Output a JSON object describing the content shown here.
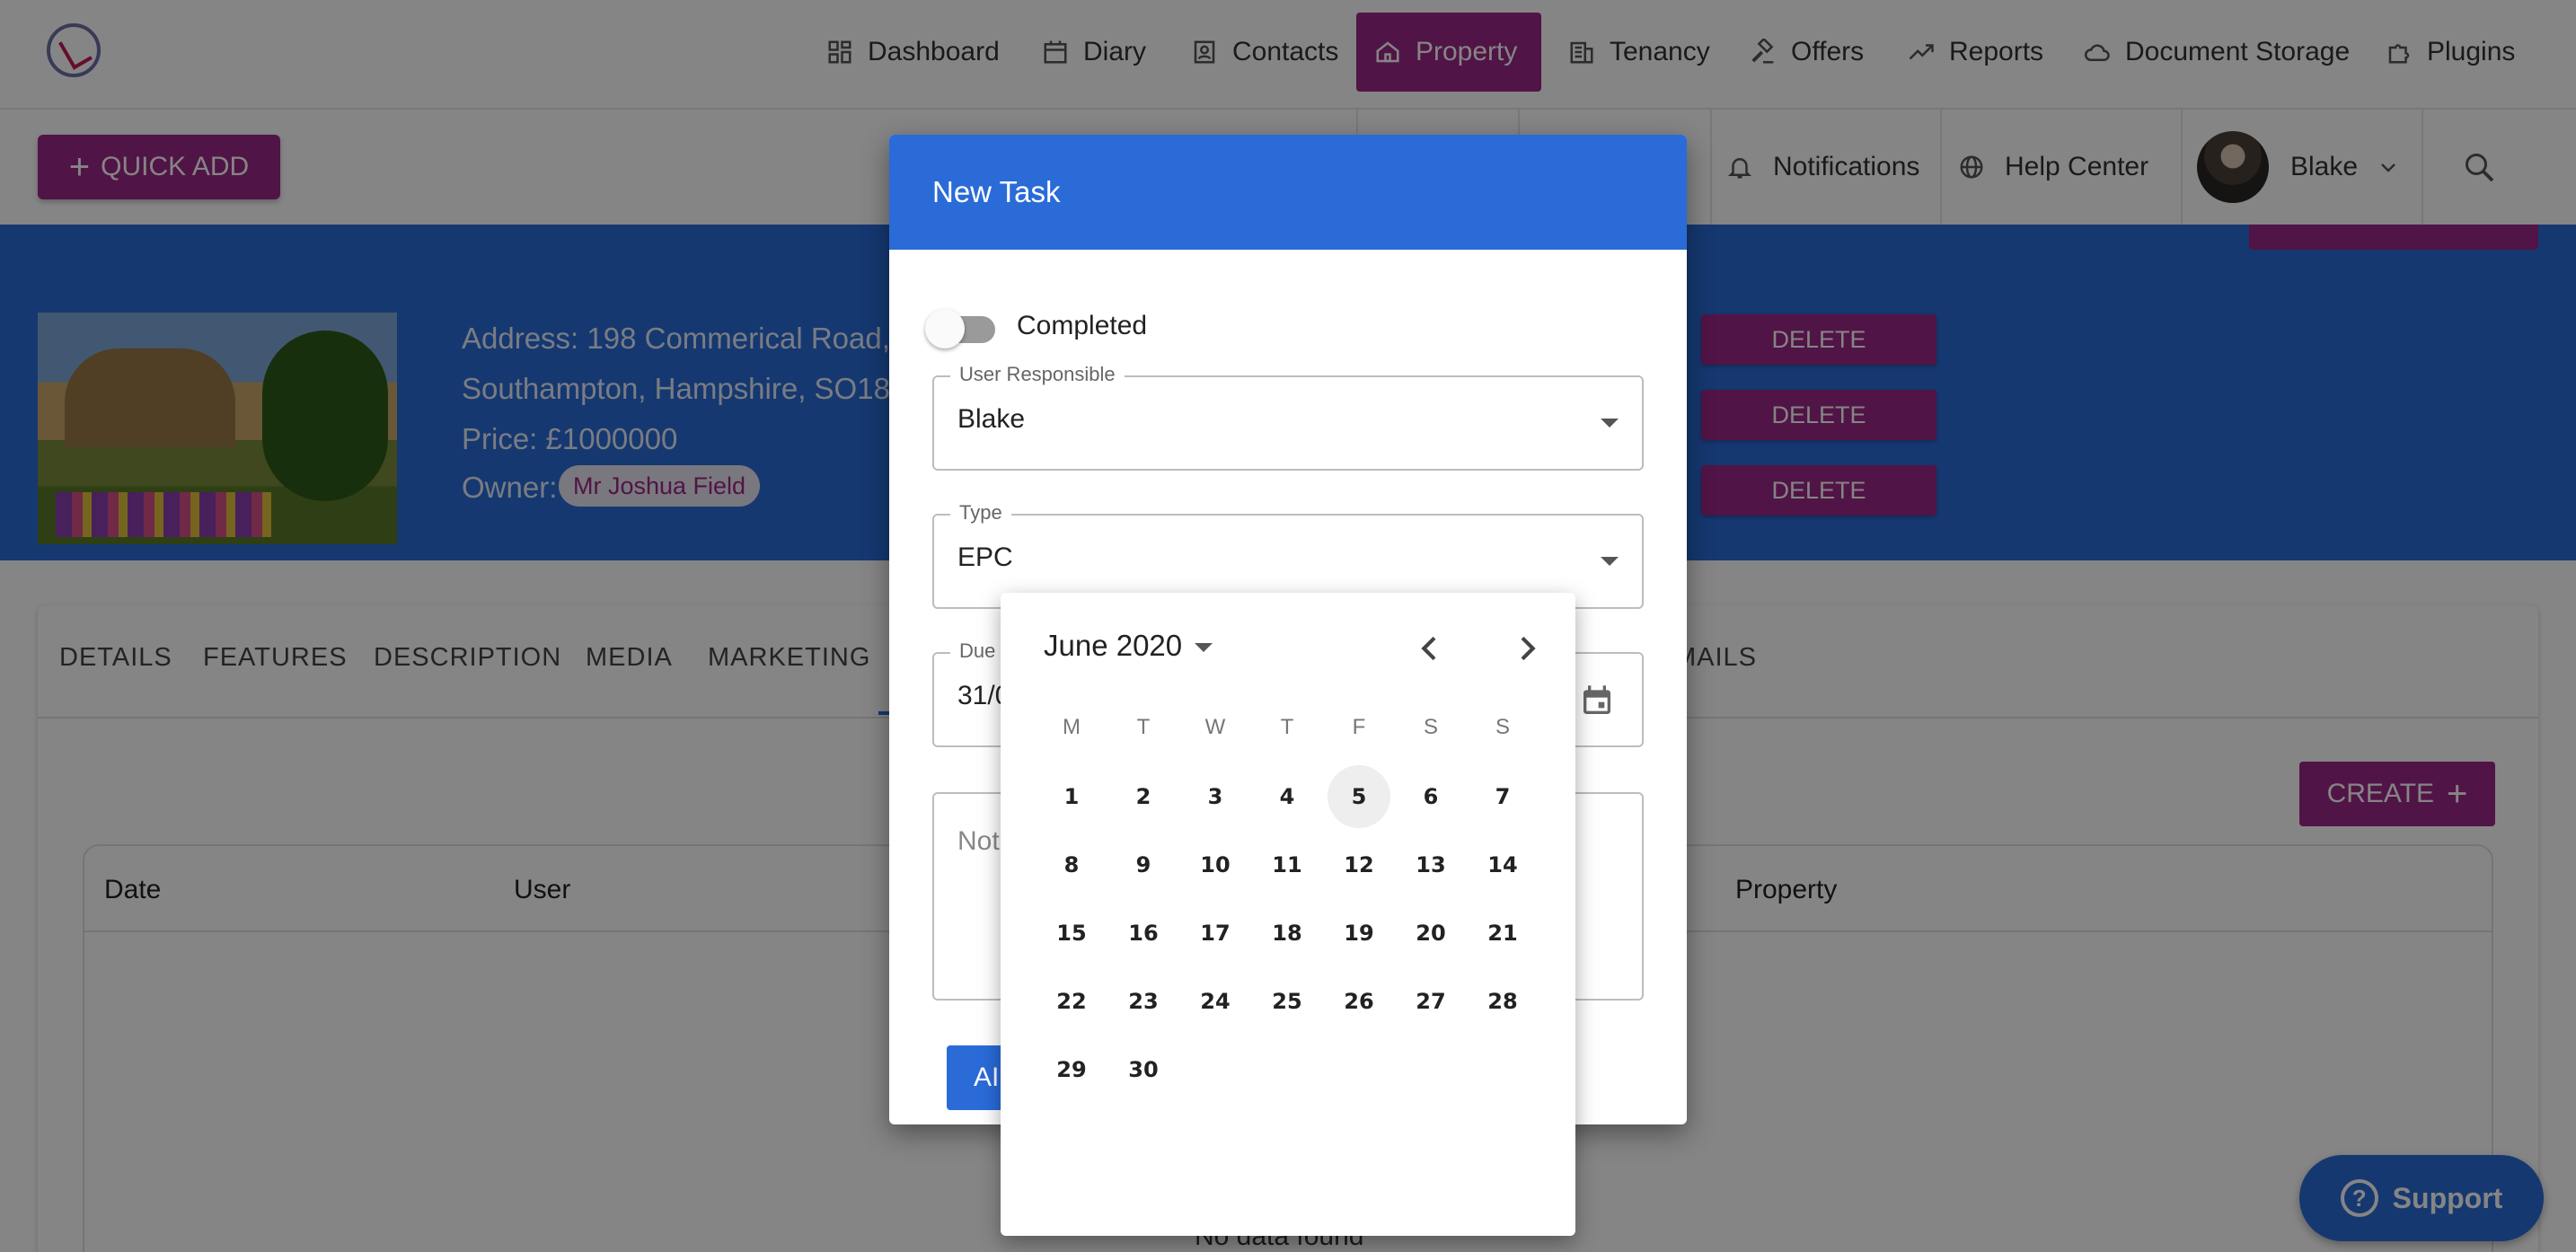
{
  "nav": {
    "items": [
      {
        "label": "Dashboard",
        "icon": "dashboard-icon"
      },
      {
        "label": "Diary",
        "icon": "calendar-icon"
      },
      {
        "label": "Contacts",
        "icon": "contacts-icon"
      },
      {
        "label": "Property",
        "icon": "home-icon",
        "active": true
      },
      {
        "label": "Tenancy",
        "icon": "building-icon"
      },
      {
        "label": "Offers",
        "icon": "gavel-icon"
      },
      {
        "label": "Reports",
        "icon": "trend-icon"
      },
      {
        "label": "Document Storage",
        "icon": "cloud-icon"
      },
      {
        "label": "Plugins",
        "icon": "puzzle-icon"
      }
    ]
  },
  "toolbar": {
    "quick_add": "QUICK ADD",
    "notifications": "Notifications",
    "help_center": "Help Center",
    "user_name": "Blake"
  },
  "property": {
    "address_line1": "Address: 198 Commerical Road,",
    "address_line2": "Southampton, Hampshire, SO18",
    "price": "Price: £1000000",
    "owner_label": "Owner:",
    "owner_name": "Mr Joshua Field",
    "delete_label": "DELETE"
  },
  "tabs": [
    "DETAILS",
    "FEATURES",
    "DESCRIPTION",
    "MEDIA",
    "MARKETING",
    "MAILS"
  ],
  "table": {
    "create_label": "CREATE",
    "headers": [
      "Date",
      "User",
      "Property"
    ],
    "empty": "No data found"
  },
  "dialog": {
    "title": "New Task",
    "completed_label": "Completed",
    "user_label": "User Responsible",
    "user_value": "Blake",
    "type_label": "Type",
    "type_value": "EPC",
    "due_label": "Due l",
    "due_value": "31/0",
    "notes_placeholder": "Not",
    "add_label": "AI"
  },
  "picker": {
    "month": "June 2020",
    "weekdays": [
      "M",
      "T",
      "W",
      "T",
      "F",
      "S",
      "S"
    ],
    "days": [
      "1",
      "2",
      "3",
      "4",
      "5",
      "6",
      "7",
      "8",
      "9",
      "10",
      "11",
      "12",
      "13",
      "14",
      "15",
      "16",
      "17",
      "18",
      "19",
      "20",
      "21",
      "22",
      "23",
      "24",
      "25",
      "26",
      "27",
      "28",
      "29",
      "30"
    ],
    "today": "5"
  },
  "support": {
    "label": "Support"
  },
  "colors": {
    "primary": "#2a6bd8",
    "accent": "#9c2787"
  }
}
